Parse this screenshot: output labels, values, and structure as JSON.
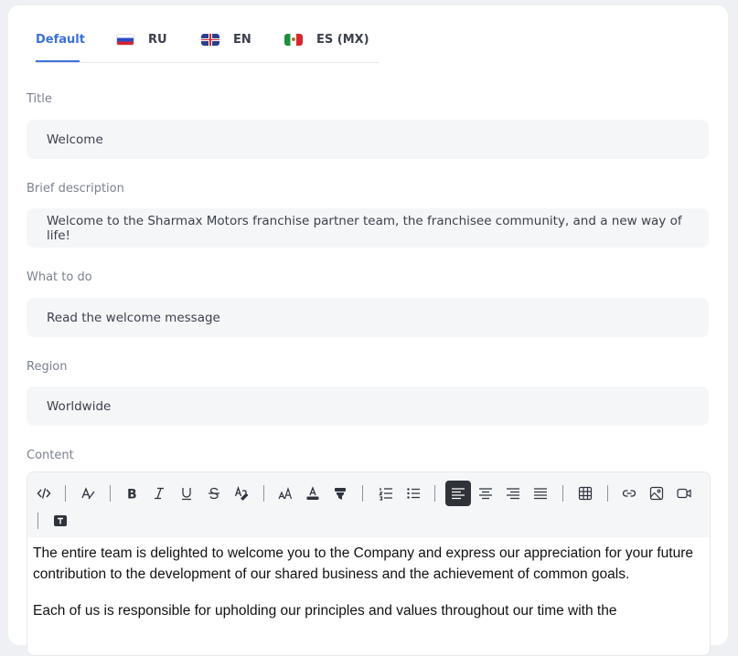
{
  "tabs": [
    {
      "label": "Default",
      "flag": null,
      "active": true
    },
    {
      "label": "RU",
      "flag": "flag-ru-icon",
      "active": false
    },
    {
      "label": "EN",
      "flag": "flag-gb-icon",
      "active": false
    },
    {
      "label": "ES (MX)",
      "flag": "flag-mx-icon",
      "active": false
    }
  ],
  "fields": {
    "title": {
      "label": "Title",
      "value": "Welcome"
    },
    "brief": {
      "label": "Brief description",
      "value": "Welcome to the Sharmax Motors franchise partner team, the franchisee community, and a new way of life!"
    },
    "todo": {
      "label": "What to do",
      "value": "Read the welcome message"
    },
    "region": {
      "label": "Region",
      "value": "Worldwide"
    },
    "content": {
      "label": "Content"
    }
  },
  "toolbar": {
    "icons": [
      "code-view-icon",
      "clear-format-icon",
      "bold-icon",
      "italic-icon",
      "underline-icon",
      "strikethrough-icon",
      "highlight-icon",
      "font-size-icon",
      "font-color-icon",
      "background-color-icon",
      "ordered-list-icon",
      "bullet-list-icon",
      "align-left-icon",
      "align-center-icon",
      "align-right-icon",
      "align-justify-icon",
      "table-icon",
      "link-icon",
      "image-icon",
      "video-icon",
      "text-block-icon"
    ],
    "active": "align-left-icon",
    "accent": "#2f3238"
  },
  "content": {
    "paragraphs": [
      "The entire team is delighted to welcome you to the Company and express our appreciation for your future contribution to the development of our shared business and the achievement of common goals.",
      "Each of us is responsible for upholding our principles and values throughout our time with the"
    ]
  },
  "colors": {
    "accent": "#3d6fd9",
    "field_bg": "#f5f6f8",
    "label": "#7b8190"
  }
}
